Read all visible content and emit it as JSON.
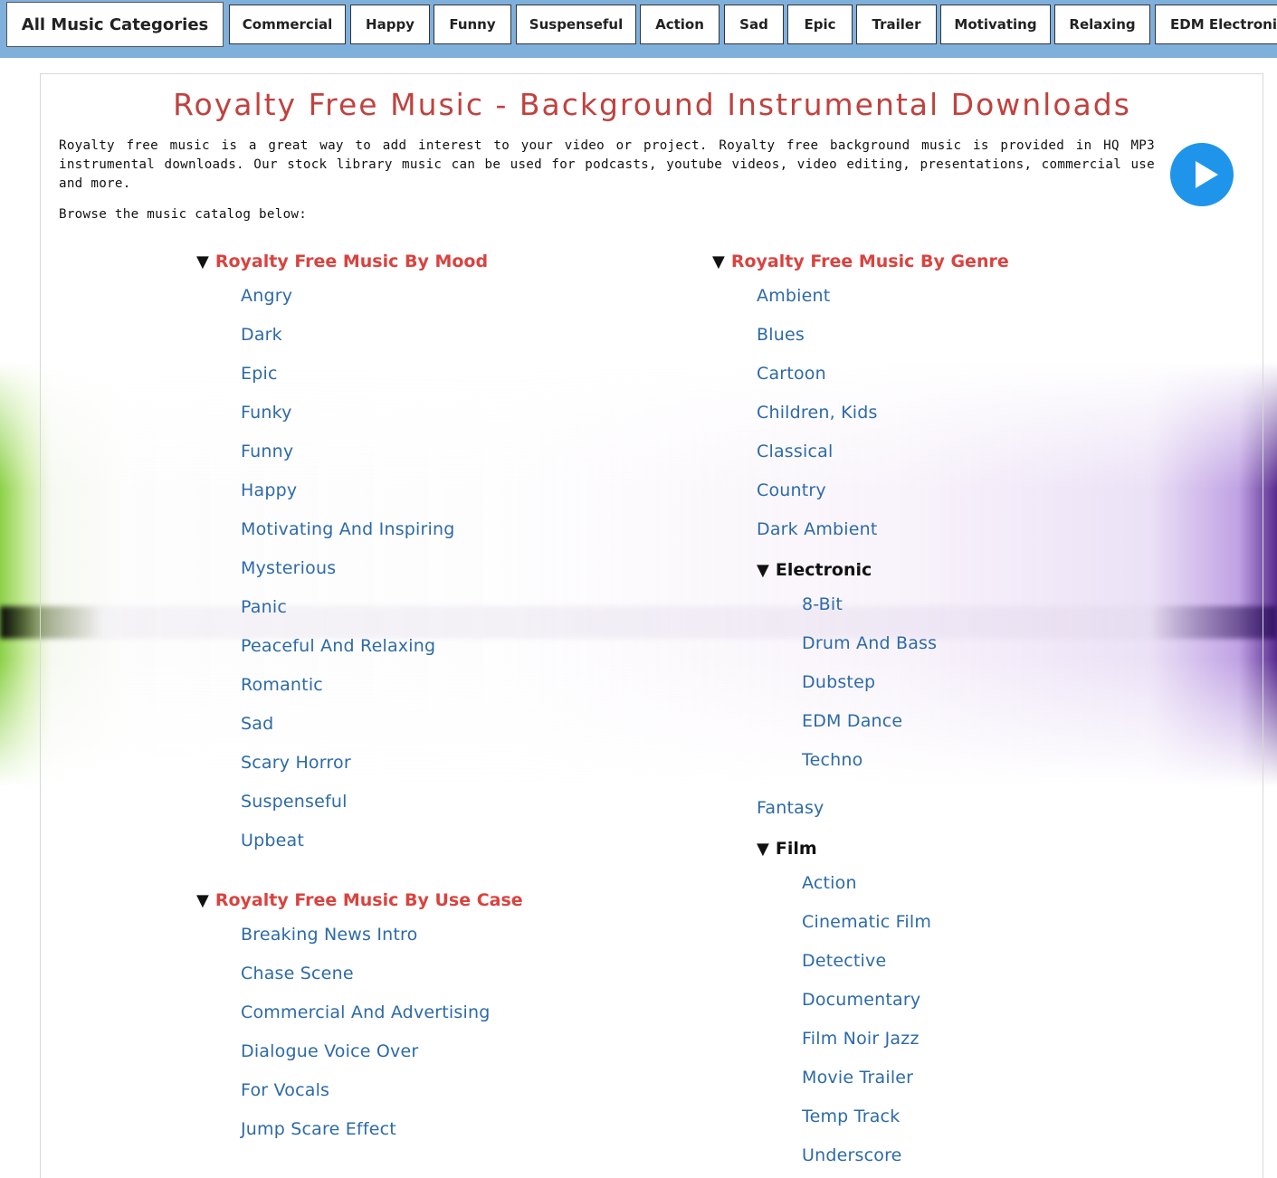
{
  "nav": {
    "all_label": "All Music Categories",
    "items": [
      "Commercial",
      "Happy",
      "Funny",
      "Suspenseful",
      "Action",
      "Sad",
      "Epic",
      "Trailer",
      "Motivating",
      "Relaxing",
      "EDM Electronic"
    ]
  },
  "header": {
    "title": "Royalty Free Music - Background Instrumental Downloads",
    "intro": "Royalty free music is a great way to add interest to your video or project. Royalty free background music is provided in HQ MP3 instrumental downloads. Our stock library music can be used for podcasts, youtube videos, video editing, presentations, commercial use and more.",
    "browse": "Browse the music catalog below:",
    "play_icon": "play-icon"
  },
  "mood": {
    "heading": "Royalty Free Music By Mood",
    "items": [
      "Angry",
      "Dark",
      "Epic",
      "Funky",
      "Funny",
      "Happy",
      "Motivating And Inspiring",
      "Mysterious",
      "Panic",
      "Peaceful And Relaxing",
      "Romantic",
      "Sad",
      "Scary Horror",
      "Suspenseful",
      "Upbeat"
    ]
  },
  "usecase": {
    "heading": "Royalty Free Music By Use Case",
    "items": [
      "Breaking News Intro",
      "Chase Scene",
      "Commercial And Advertising",
      "Dialogue Voice Over",
      "For Vocals",
      "Jump Scare Effect"
    ]
  },
  "genre": {
    "heading": "Royalty Free Music By Genre",
    "items_a": [
      "Ambient",
      "Blues",
      "Cartoon",
      "Children, Kids",
      "Classical",
      "Country",
      "Dark Ambient"
    ],
    "electronic": {
      "heading": "Electronic",
      "items": [
        "8-Bit",
        "Drum And Bass",
        "Dubstep",
        "EDM Dance",
        "Techno"
      ]
    },
    "items_b": [
      "Fantasy"
    ],
    "film": {
      "heading": "Film",
      "items": [
        "Action",
        "Cinematic Film",
        "Detective",
        "Documentary",
        "Film Noir Jazz",
        "Movie Trailer",
        "Temp Track",
        "Underscore"
      ]
    }
  },
  "colors": {
    "nav_bar": "#7fb0dc",
    "heading_red": "#d9433f",
    "link_blue": "#2d6aa8",
    "play_blue": "#1e95ea"
  }
}
